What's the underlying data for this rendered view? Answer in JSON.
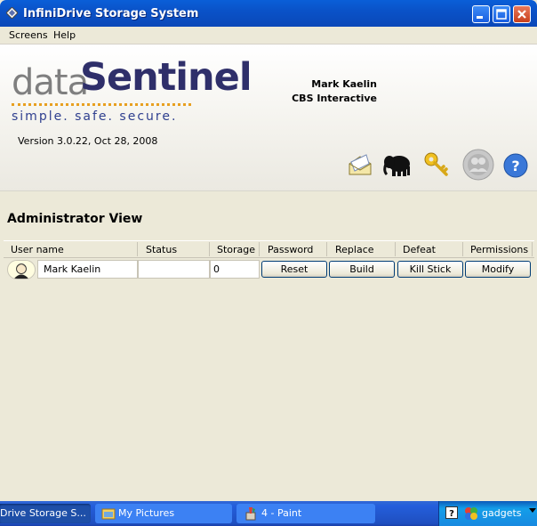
{
  "window": {
    "title": "InfiniDrive Storage System"
  },
  "menu": {
    "items": [
      "Screens",
      "Help"
    ]
  },
  "header": {
    "logo_data": "data",
    "logo_sentinel": "Sentinel",
    "tagline": "simple.  safe.  secure.",
    "version": "Version 3.0.22,  Oct 28, 2008",
    "user_name": "Mark Kaelin",
    "company": "CBS Interactive",
    "toolbar_icons": [
      "envelope-icon",
      "elephant-icon",
      "key-icon",
      "users-icon",
      "help-icon"
    ]
  },
  "main": {
    "view_title": "Administrator View",
    "columns": [
      "User name",
      "Status",
      "Storage",
      "Password",
      "Replace",
      "Defeat",
      "Permissions"
    ],
    "rows": [
      {
        "user_name": "Mark Kaelin",
        "status": "",
        "storage": "0",
        "password_btn": "Reset",
        "replace_btn": "Build",
        "defeat_btn": "Kill Stick",
        "permissions_btn": "Modify"
      }
    ]
  },
  "taskbar": {
    "tasks": [
      "Drive Storage S...",
      "My Pictures",
      "4 - Paint"
    ],
    "tray_label": "gadgets"
  },
  "colors": {
    "titlebar": "#0a52c8",
    "logo_primary": "#2f2f6a",
    "logo_secondary": "#7f7f7f",
    "tagline": "#2f3f8f",
    "accent_dots": "#e8a020"
  }
}
